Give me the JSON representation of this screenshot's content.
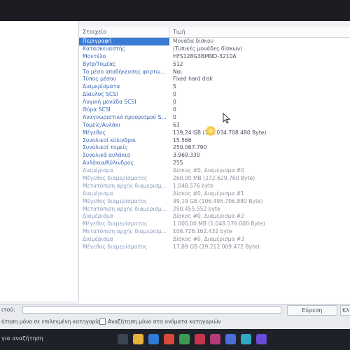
{
  "table": {
    "header_item": "Στοιχείο",
    "header_value": "Τιμή",
    "rows": [
      {
        "label": "Περιγραφή",
        "value": "Μονάδα δίσκου",
        "style": "sel"
      },
      {
        "label": "Κατασκευαστής",
        "value": "(Τυπικές μονάδες δίσκων)",
        "style": "n"
      },
      {
        "label": "Μοντέλο",
        "value": "HFS128G3BMND-3210A",
        "style": "n"
      },
      {
        "label": "Byte/Τομέας",
        "value": "512",
        "style": "n"
      },
      {
        "label": "Το μέσο αποθήκευσης φορτω...",
        "value": "Ναι",
        "style": "n"
      },
      {
        "label": "Τύπος μέσου",
        "value": "Fixed hard disk",
        "style": "n"
      },
      {
        "label": "Διαμερίσματα",
        "value": "5",
        "style": "n"
      },
      {
        "label": "Δίαυλος SCSI",
        "value": "0",
        "style": "n"
      },
      {
        "label": "Λογική μονάδα SCSI",
        "value": "0",
        "style": "n"
      },
      {
        "label": "Θύρα SCSI",
        "value": "0",
        "style": "n"
      },
      {
        "label": "Αναγνωριστικό προορισμού S...",
        "value": "0",
        "style": "n"
      },
      {
        "label": "Τομείς/Αυλάκι",
        "value": "63",
        "style": "n"
      },
      {
        "label": "Μέγεθος",
        "value": "119,24 GB (128.034.708.480 Byte)",
        "style": "n"
      },
      {
        "label": "Συνολικοί κύλινδροι",
        "value": "15.566",
        "style": "n"
      },
      {
        "label": "Συνολικοί τομείς",
        "value": "250.067.790",
        "style": "n"
      },
      {
        "label": "Συνολικά αυλάκια",
        "value": "3.969.330",
        "style": "n"
      },
      {
        "label": "Αυλάκια/Κύλινδρος",
        "value": "255",
        "style": "n"
      },
      {
        "label": "Διαμέρισμα",
        "value": "Δίσκος #0, Διαμέρισμα #0",
        "style": "f"
      },
      {
        "label": "Μέγεθος διαμερίσματος",
        "value": "260,00 MB (272.629.760 Byte)",
        "style": "f"
      },
      {
        "label": "Μετατόπιση αρχής διαμερισμ...",
        "value": "1.048.576 byte",
        "style": "f"
      },
      {
        "label": "Διαμέρισμα",
        "value": "Δίσκος #0, Διαμέρισμα #1",
        "style": "f"
      },
      {
        "label": "Μέγεθος διαμερίσματος",
        "value": "99,19 GB (106.495.706.880 Byte)",
        "style": "f"
      },
      {
        "label": "Μετατόπιση αρχής διαμερισμ...",
        "value": "290.455.552 byte",
        "style": "f"
      },
      {
        "label": "Διαμέρισμα",
        "value": "Δίσκος #0, Διαμέρισμα #2",
        "style": "f"
      },
      {
        "label": "Μέγεθος διαμερίσματος",
        "value": "1.000,00 MB (1.048.576.000 Byte)",
        "style": "f"
      },
      {
        "label": "Μετατόπιση αρχής διαμερισμ...",
        "value": "106.726.162.432 byte",
        "style": "f"
      },
      {
        "label": "Διαμέρισμα",
        "value": "Δίσκος #0, Διαμέρισμα #3",
        "style": "f"
      },
      {
        "label": "Μέγεθος διαμερίσματος",
        "value": "17,89 GB (19.212.009.472 Byte)",
        "style": "f"
      }
    ]
  },
  "search": {
    "label": "ιτού:",
    "value": "",
    "find_label": "Εύρεση",
    "close_label": "Κλ"
  },
  "options": {
    "selected_category": "ήτηση μόνο σε επιλεγμένη κατηγορία",
    "category_names": "Αναζήτηση μόνο στα ονόματα κατηγοριών"
  },
  "taskbar": {
    "search_text": "για αναζήτηση"
  },
  "colors": {
    "selection": "#3a7bd5",
    "link_label": "#3b67b3",
    "faded_label": "#8a9bbd"
  }
}
